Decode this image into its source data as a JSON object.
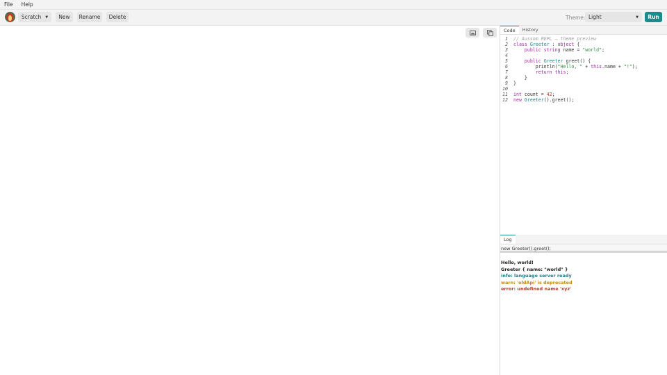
{
  "menu": {
    "items": [
      "File",
      "Help"
    ]
  },
  "toolbar": {
    "scratch_label": "Scratch",
    "new_label": "New",
    "rename_label": "Rename",
    "delete_label": "Delete",
    "theme_label": "Theme:",
    "theme_value": "Light",
    "run_label": "Run"
  },
  "canvas": {
    "icons": [
      "image-icon",
      "copy-icon"
    ]
  },
  "editor": {
    "tabs": [
      "Code",
      "History"
    ],
    "active_tab": "Code",
    "lines": [
      {
        "n": "1",
        "t": "// Aussom REPL — theme preview"
      },
      {
        "n": "2",
        "t": "class Greeter : object {"
      },
      {
        "n": "3",
        "t": "    public string name = \"world\";"
      },
      {
        "n": "4",
        "t": ""
      },
      {
        "n": "5",
        "t": "    public Greeter greet() {"
      },
      {
        "n": "6",
        "t": "        println(\"Hello, \" + this.name + \"!\");"
      },
      {
        "n": "7",
        "t": "        return this;"
      },
      {
        "n": "8",
        "t": "    }"
      },
      {
        "n": "9",
        "t": "}"
      },
      {
        "n": "10",
        "t": ""
      },
      {
        "n": "11",
        "t": "int count = 42;"
      },
      {
        "n": "12",
        "t": "new Greeter().greet();"
      }
    ]
  },
  "log": {
    "tab": "Log",
    "input_value": "new Greeter().greet();",
    "lines": [
      {
        "text": "Hello, world!",
        "level": "plain"
      },
      {
        "text": "Greeter { name: \"world\" }",
        "level": "plain"
      },
      {
        "text": "info: language server ready",
        "level": "info"
      },
      {
        "text": "warn: 'oldApi' is deprecated",
        "level": "warn"
      },
      {
        "text": "error: undefined name 'xyz'",
        "level": "error"
      }
    ]
  },
  "colors": {
    "accent": "#1b8c8c",
    "info": "#1b7d8a",
    "warn": "#c8860b",
    "error": "#c0392b"
  }
}
